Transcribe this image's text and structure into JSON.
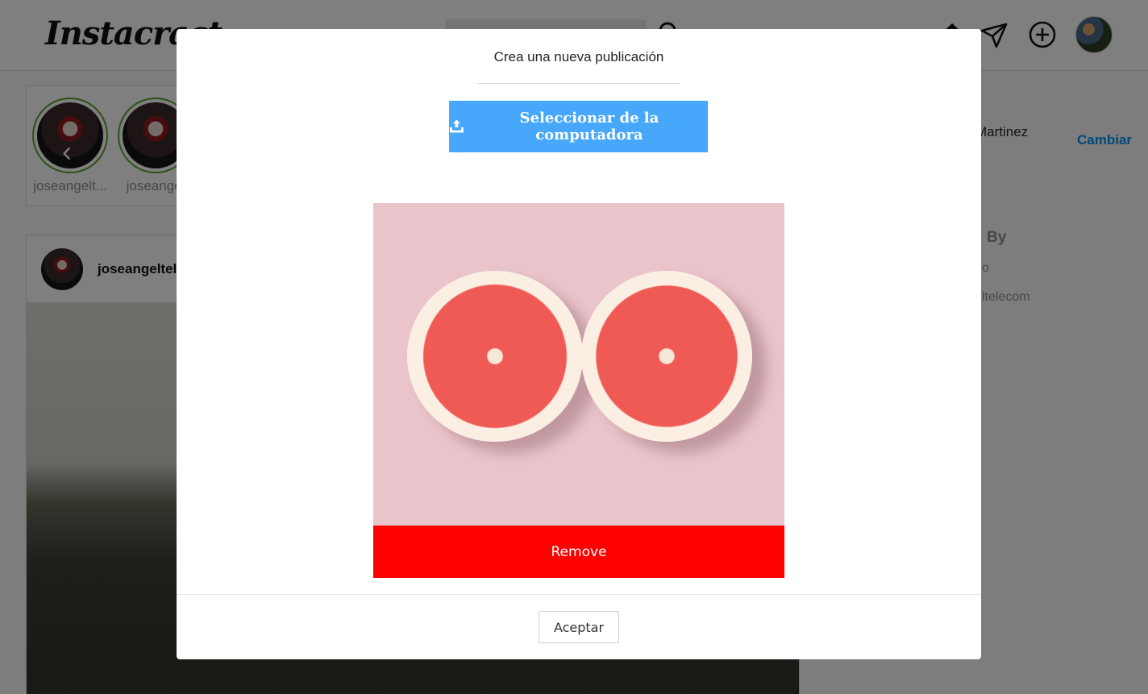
{
  "header": {
    "logo": "Instacract",
    "icons": [
      "search-icon",
      "home-icon",
      "send-icon",
      "add-icon",
      "avatar"
    ]
  },
  "stories": {
    "items": [
      {
        "name": "joseangelt..."
      },
      {
        "name": "joseangel"
      }
    ]
  },
  "post": {
    "username": "joseangeltel"
  },
  "sidebar": {
    "name": "Martinez",
    "switch_label": "Cambiar",
    "suggestions_title": "By",
    "suggestion_1": "o",
    "suggestion_2": "ltelecom"
  },
  "modal": {
    "title": "Crea una nueva publicación",
    "upload_label": "Seleccionar de la computadora",
    "remove_label": "Remove",
    "accept_label": "Aceptar"
  },
  "colors": {
    "upload_button": "#47a7fb",
    "remove_button": "#ff0000",
    "link_blue": "#0095f6",
    "overlay": "rgba(0,0,0,0.5)"
  }
}
